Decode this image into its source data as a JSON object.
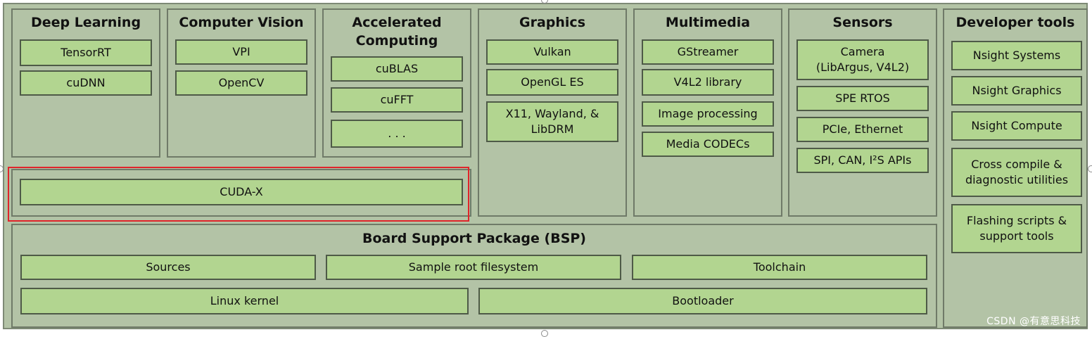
{
  "panels": {
    "deep_learning": {
      "title": "Deep Learning",
      "items": [
        "TensorRT",
        "cuDNN"
      ]
    },
    "computer_vision": {
      "title": "Computer Vision",
      "items": [
        "VPI",
        "OpenCV"
      ]
    },
    "accelerated_computing": {
      "title": "Accelerated\nComputing",
      "items": [
        "cuBLAS",
        "cuFFT",
        ". . ."
      ]
    },
    "graphics": {
      "title": "Graphics",
      "items": [
        "Vulkan",
        "OpenGL ES",
        "X11, Wayland, &\nLibDRM"
      ]
    },
    "multimedia": {
      "title": "Multimedia",
      "items": [
        "GStreamer",
        "V4L2 library",
        "Image processing",
        "Media CODECs"
      ]
    },
    "sensors": {
      "title": "Sensors",
      "items": [
        "Camera\n(LibArgus, V4L2)",
        "SPE RTOS",
        "PCIe, Ethernet",
        "SPI, CAN, I²S APIs"
      ]
    },
    "developer_tools": {
      "title": "Developer tools",
      "items": [
        "Nsight Systems",
        "Nsight Graphics",
        "Nsight Compute",
        "Cross compile &\ndiagnostic utilities",
        "Flashing scripts &\nsupport tools"
      ]
    },
    "cuda": {
      "items": [
        "CUDA-X"
      ]
    },
    "bsp": {
      "title": "Board Support Package (BSP)",
      "items": [
        "Sources",
        "Sample root filesystem",
        "Toolchain",
        "Linux kernel",
        "Bootloader"
      ]
    }
  },
  "watermark": "CSDN @有意思科技",
  "colors": {
    "panel": "#b3c3a6",
    "item": "#b2d590",
    "highlight": "#e0242a"
  }
}
